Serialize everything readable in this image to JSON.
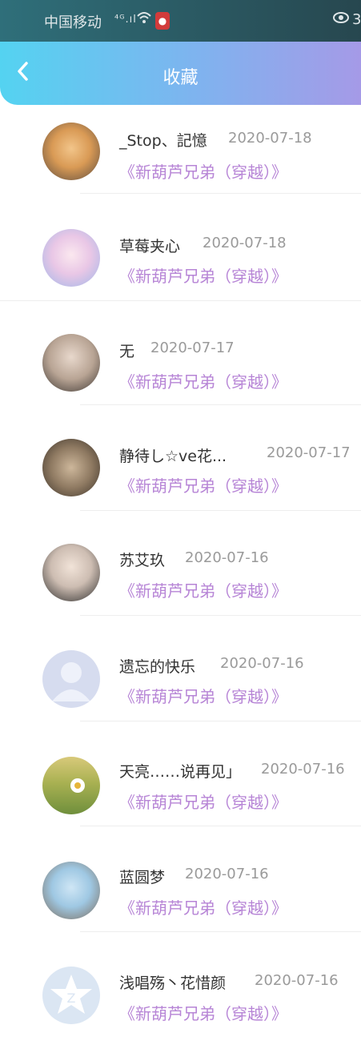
{
  "status_bar": {
    "carrier": "中国移动",
    "signal": "⁴ᴳ.ıl",
    "wifi_icon": "wifi-icon",
    "battery": "3"
  },
  "header": {
    "back_icon": "chevron-left-icon",
    "title": "收藏"
  },
  "items": [
    {
      "name": "_Stop、記憶",
      "date": "2020-07-18",
      "work": "《新葫芦兄弟（穿越）》"
    },
    {
      "name": "草莓夹心",
      "date": "2020-07-18",
      "work": "《新葫芦兄弟（穿越）》"
    },
    {
      "name": "无",
      "date": "2020-07-17",
      "work": "《新葫芦兄弟（穿越）》"
    },
    {
      "name": "静待し☆ve花...",
      "date": "2020-07-17",
      "work": "《新葫芦兄弟（穿越）》"
    },
    {
      "name": "苏艾玖",
      "date": "2020-07-16",
      "work": "《新葫芦兄弟（穿越）》"
    },
    {
      "name": "遗忘的快乐",
      "date": "2020-07-16",
      "work": "《新葫芦兄弟（穿越）》"
    },
    {
      "name": "天亮……说再见」",
      "date": "2020-07-16",
      "work": "《新葫芦兄弟（穿越）》"
    },
    {
      "name": "蓝圆梦",
      "date": "2020-07-16",
      "work": "《新葫芦兄弟（穿越）》"
    },
    {
      "name": "浅唱殇丶花惜颜",
      "date": "2020-07-16",
      "work": "《新葫芦兄弟（穿越）》"
    }
  ],
  "colors": {
    "header_gradient_start": "#54d3f1",
    "header_gradient_end": "#a59ae7",
    "work_title": "#b785d6"
  }
}
